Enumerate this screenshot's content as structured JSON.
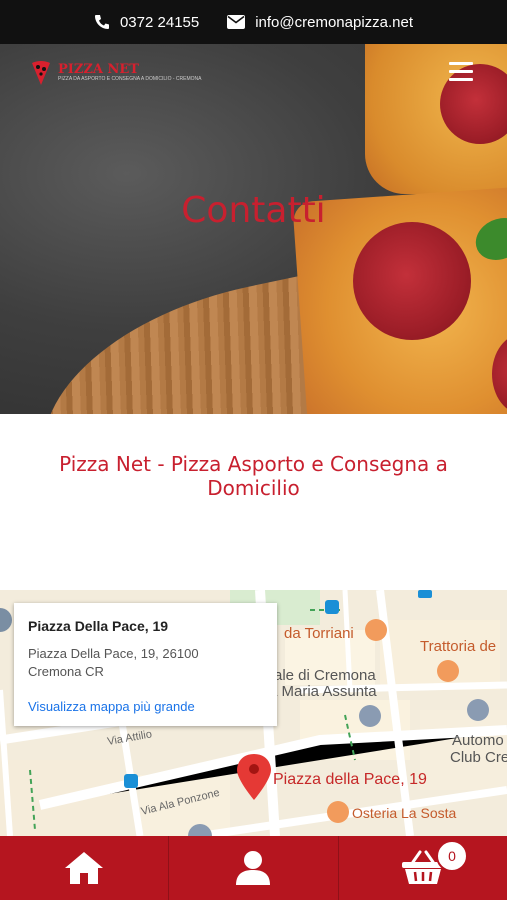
{
  "topbar": {
    "phone": "0372 24155",
    "email": "info@cremonapizza.net"
  },
  "logo": {
    "name": "PIZZA NET",
    "tagline": "PIZZA DA ASPORTO E CONSEGNA A DOMICILIO - CREMONA"
  },
  "hero": {
    "title": "Contatti"
  },
  "page": {
    "heading": "Pizza Net - Pizza Asporto e Consegna a Domicilio"
  },
  "map": {
    "card_title": "Piazza Della Pace, 19",
    "address_line1": "Piazza Della Pace, 19, 26100",
    "address_line2": "Cremona CR",
    "larger_map_link": "Visualizza mappa più grande",
    "marker_label": "Piazza della Pace, 19",
    "labels": {
      "torriani": "da Torriani",
      "trattoria": "Trattoria de",
      "cattedrale1": "rale di Cremona",
      "cattedrale2": "a Maria Assunta",
      "automobile1": "Automo",
      "automobile2": "Club Cre",
      "via_attilio": "Via Attilio",
      "via_ala": "Via Ala Ponzone",
      "osteria": "Osteria La Sosta"
    }
  },
  "cart": {
    "count": "0"
  },
  "colors": {
    "brand_red": "#c8202f",
    "bar_red": "#b5151f",
    "topbar": "#111111",
    "link": "#1a73e8"
  },
  "icons": [
    "phone-icon",
    "envelope-icon",
    "hamburger-menu-icon",
    "home-icon",
    "user-icon",
    "basket-icon",
    "map-pin-icon"
  ]
}
